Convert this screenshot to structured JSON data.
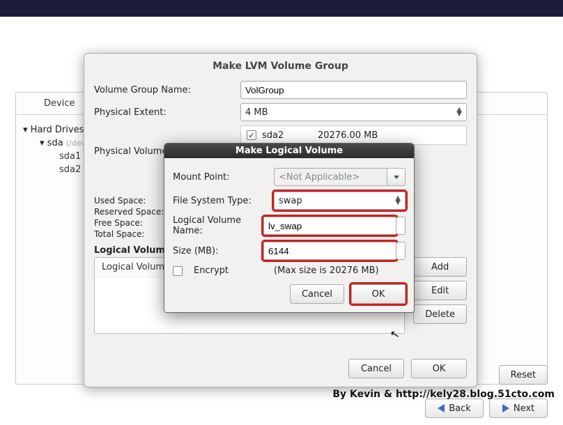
{
  "topbar": {},
  "installer": {
    "device_header": "Device",
    "tree": {
      "root": "Hard Drives",
      "disk": "sda",
      "disk_info": "(/dev/sda",
      "parts": [
        "sda1",
        "sda2"
      ]
    },
    "reset": "Reset",
    "back": "Back",
    "next": "Next"
  },
  "vg_dialog": {
    "title": "Make LVM Volume Group",
    "name_label": "Volume Group Name:",
    "name_value": "VolGroup",
    "pe_label": "Physical Extent:",
    "pe_value": "4 MB",
    "pv_label": "Physical Volumes to Use:",
    "pv_item": "sda2",
    "pv_size": "20276.00 MB",
    "used_label": "Used Space:",
    "reserved_label": "Reserved Space:",
    "free_label": "Free Space:",
    "total_label": "Total Space:",
    "lv_caption": "Logical Volumes",
    "lv_header": "Logical Volume Name",
    "add": "Add",
    "edit": "Edit",
    "delete": "Delete",
    "cancel": "Cancel",
    "ok": "OK"
  },
  "lv_modal": {
    "title": "Make Logical Volume",
    "mount_label": "Mount Point:",
    "mount_value": "<Not Applicable>",
    "fs_label": "File System Type:",
    "fs_value": "swap",
    "lvname_label": "Logical Volume Name:",
    "lvname_value": "lv_swap",
    "size_label": "Size (MB):",
    "size_value": "6144",
    "encrypt_label": "Encrypt",
    "max_hint": "(Max size is 20276 MB)",
    "cancel": "Cancel",
    "ok": "OK"
  },
  "credit": "By Kevin & http://kely28.blog.51cto.com"
}
